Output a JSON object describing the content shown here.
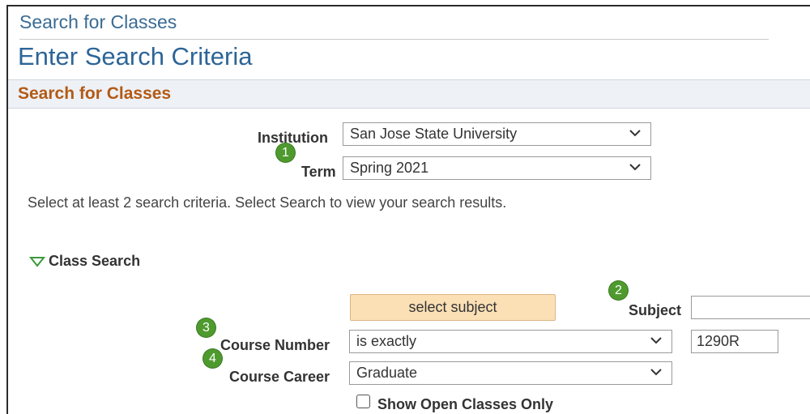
{
  "header": {
    "breadcrumb": "Search for Classes",
    "title": "Enter Search Criteria"
  },
  "section": {
    "title": "Search for Classes"
  },
  "institution": {
    "label": "Institution",
    "value": "San Jose State University"
  },
  "term": {
    "label": "Term",
    "value": "Spring 2021"
  },
  "instructions": "Select at least 2 search criteria. Select Search to view your search results.",
  "class_search": {
    "heading": "Class Search",
    "select_subject_label": "select subject",
    "subject": {
      "label": "Subject",
      "value": ""
    },
    "course_number": {
      "label": "Course Number",
      "operator": "is exactly",
      "value": "1290R"
    },
    "course_career": {
      "label": "Course Career",
      "value": "Graduate"
    },
    "show_open": {
      "label": "Show Open Classes Only",
      "checked": false
    }
  },
  "callouts": [
    "1",
    "2",
    "3",
    "4"
  ],
  "colors": {
    "title_blue": "#2d6597",
    "section_orange": "#b35a15",
    "badge_green": "#4e9a2e",
    "button_bg": "#fbe0b6"
  }
}
